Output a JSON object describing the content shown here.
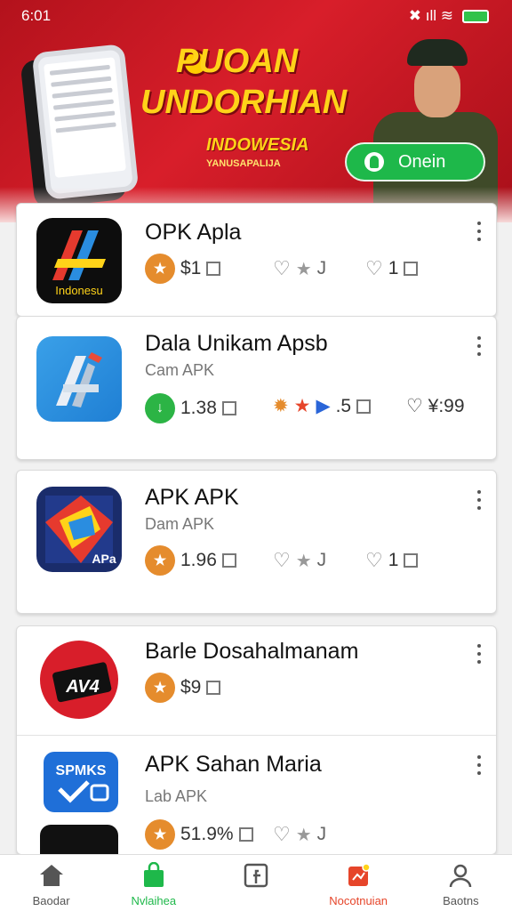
{
  "status_bar": {
    "time": "6:01",
    "signal_text": "✖ ıll ≋"
  },
  "banner": {
    "title_line1": "PUOAN",
    "title_line2": "UNDORHIAN",
    "subtitle": "INDOWESIA",
    "tagline": "YANUSAPALIJA",
    "button_label": "Onein",
    "colors": {
      "background": "#c8161f",
      "title": "#ffd319",
      "button": "#1eb84a"
    }
  },
  "apps": [
    {
      "name": "OPK Apla",
      "sub": "",
      "icon_label": "Indonesu",
      "icon": "ndonesia-app-icon",
      "stats": [
        {
          "badge": "star-badge",
          "text": "$1"
        },
        {
          "badge": "heart-icon",
          "text": "♡ ★J"
        },
        {
          "badge": "heart-icon",
          "text": "♡ 1"
        }
      ]
    },
    {
      "name": "Dala Unikam Apsb",
      "sub": "Cam APK",
      "icon": "design-app-icon",
      "stats": [
        {
          "badge": "download-badge",
          "text": "1.38"
        },
        {
          "badge": "gear-star-icon",
          "text": ".5"
        },
        {
          "badge": "heart-icon",
          "text": "♡ ¥:99"
        }
      ]
    },
    {
      "name": "APK APK",
      "sub": "Dam APK",
      "icon_label": "APa",
      "icon": "apk-app-icon",
      "stats": [
        {
          "badge": "star-badge",
          "text": "1.96"
        },
        {
          "badge": "heart-icon",
          "text": "♡ ★J"
        },
        {
          "badge": "heart-icon",
          "text": "♡ 1"
        }
      ]
    },
    {
      "name": "Barle Dosahalmanam",
      "sub": "",
      "icon_label": "AV4",
      "icon": "stream-app-icon",
      "stats": [
        {
          "badge": "star-badge",
          "text": "$9"
        }
      ]
    },
    {
      "name": "APK Sahan Maria",
      "sub": "Lab APK",
      "icon_label": "SPMKS",
      "icon": "check-app-icon",
      "stats": [
        {
          "badge": "star-badge",
          "text": "51.9%"
        },
        {
          "badge": "heart-icon",
          "text": "♡ ★J"
        }
      ]
    }
  ],
  "nav": [
    {
      "label": "Baodar",
      "icon": "home-icon"
    },
    {
      "label": "Nvlaihea",
      "icon": "store-icon"
    },
    {
      "label": "",
      "icon": "facebook-icon"
    },
    {
      "label": "Nocotnuian",
      "icon": "notification-icon"
    },
    {
      "label": "Baotns",
      "icon": "profile-icon"
    }
  ]
}
